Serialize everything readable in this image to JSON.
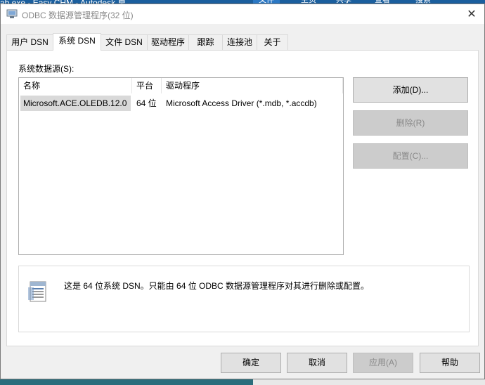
{
  "background": {
    "strip_text": "ab.exe - Easy CHM - Autodesk 桌 ...",
    "tab_labels": [
      "文件",
      "主页",
      "共享",
      "查看",
      "搜索"
    ]
  },
  "window": {
    "title": "ODBC 数据源管理程序(32 位)",
    "close_glyph": "✕"
  },
  "tabs": [
    {
      "label": "用户 DSN",
      "active": false
    },
    {
      "label": "系统 DSN",
      "active": true
    },
    {
      "label": "文件 DSN",
      "active": false
    },
    {
      "label": "驱动程序",
      "active": false
    },
    {
      "label": "跟踪",
      "active": false
    },
    {
      "label": "连接池",
      "active": false
    },
    {
      "label": "关于",
      "active": false
    }
  ],
  "panel": {
    "list_label": "系统数据源(S):",
    "columns": [
      "名称",
      "平台",
      "驱动程序"
    ],
    "rows": [
      {
        "name": "Microsoft.ACE.OLEDB.12.0",
        "platform": "64 位",
        "driver": "Microsoft Access Driver (*.mdb, *.accdb)"
      }
    ],
    "buttons": {
      "add": "添加(D)...",
      "remove": "删除(R)",
      "configure": "配置(C)..."
    },
    "info_text": "这是 64 位系统 DSN。只能由 64 位 ODBC 数据源管理程序对其进行删除或配置。",
    "info_icon": "database-icon"
  },
  "footer": {
    "ok": "确定",
    "cancel": "取消",
    "apply": "应用(A)",
    "help": "帮助"
  },
  "colors": {
    "dialog_bg": "#f0f0f0",
    "selected_row": "#d9d9d9",
    "button_bg": "#e1e1e1",
    "disabled_bg": "#cccccc",
    "disabled_text": "#8a8a8a"
  }
}
